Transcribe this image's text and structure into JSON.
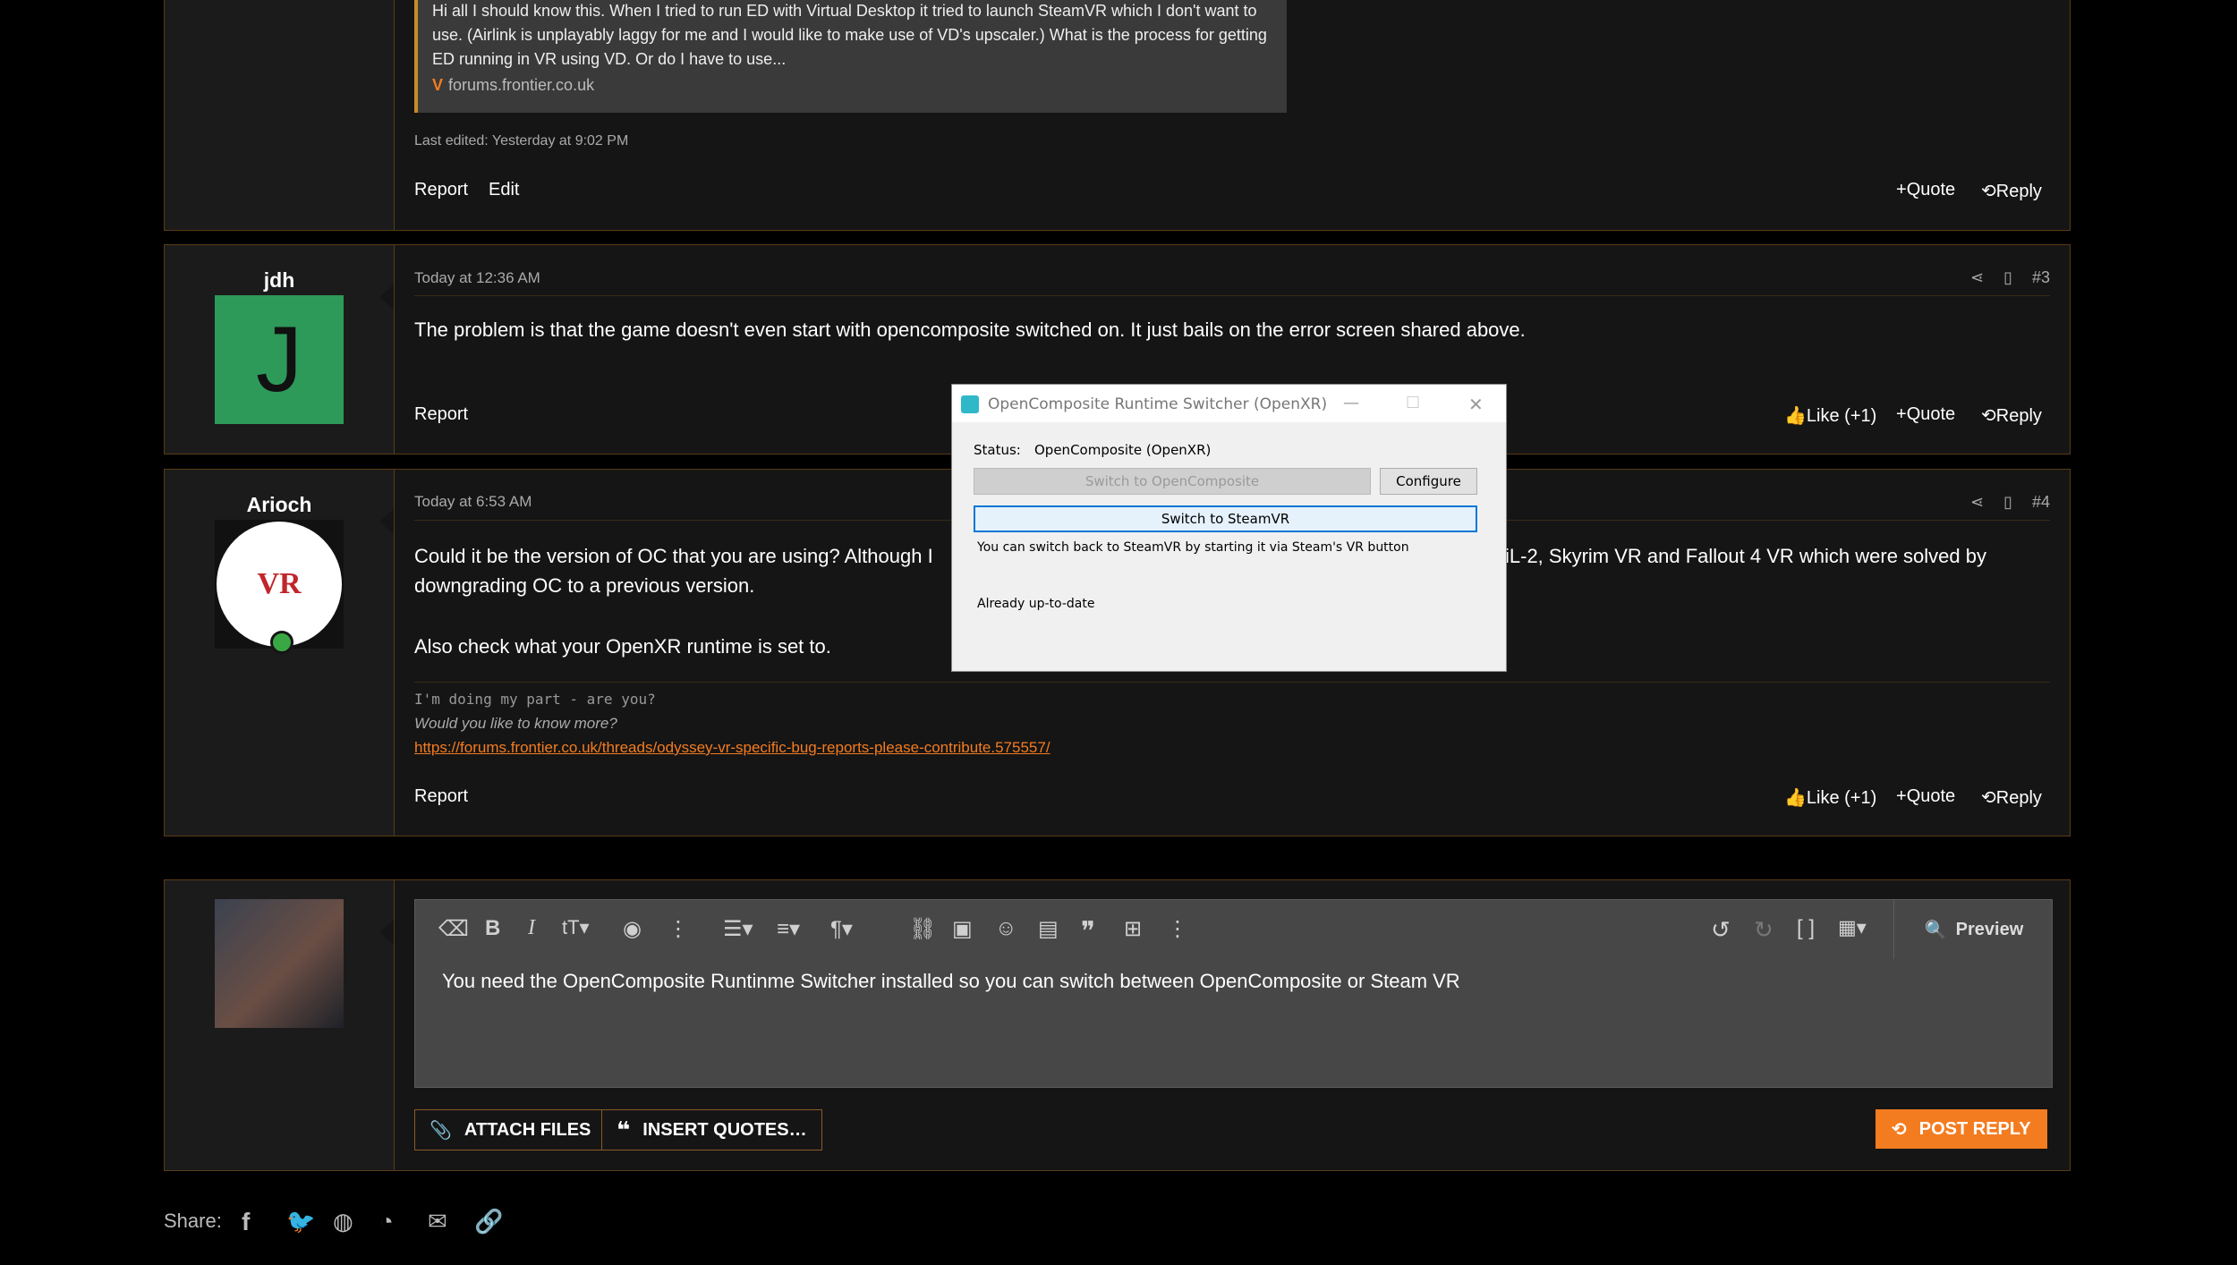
{
  "post2": {
    "quote_text": "Hi all I should know this. When I tried to run ED with Virtual Desktop it tried to launch SteamVR which I don't want to use. (Airlink is unplayably laggy for me and I would like to make use of VD's upscaler.) What is the process for getting ED running in VR using VD. Or do I have to use...",
    "quote_source": "forums.frontier.co.uk",
    "last_edited": "Last edited: Yesterday at 9:02 PM",
    "report": "Report",
    "edit": "Edit",
    "quote": "Quote",
    "reply": "Reply"
  },
  "post3": {
    "username": "jdh",
    "avatar_letter": "J",
    "avatar_color": "#2e9a5a",
    "time": "Today at 12:36 AM",
    "number": "#3",
    "text": "The problem is that the game doesn't even start with opencomposite switched on. It just bails on the error screen shared above.",
    "report": "Report",
    "like": "Like (+1)",
    "quote": "Quote",
    "reply": "Reply"
  },
  "post4": {
    "username": "Arioch",
    "avatar_text": "VR",
    "time": "Today at 6:53 AM",
    "number": "#4",
    "text_a": "Could it be the version of OC that you are using? Although I",
    "text_b": "iL-2, Skyrim VR and Fallout 4 VR which were solved by",
    "text_c": "downgrading OC to a previous version.",
    "text_d": "Also check what your OpenXR runtime is set to.",
    "sig1": "I'm doing my part - are you?",
    "sig2": "Would you like to know more?",
    "sig_link": "https://forums.frontier.co.uk/threads/odyssey-vr-specific-bug-reports-please-contribute.575557/",
    "report": "Report",
    "like": "Like (+1)",
    "quote": "Quote",
    "reply": "Reply"
  },
  "editor": {
    "text": "You need the OpenComposite Runtinme Switcher installed so you can switch between OpenComposite or Steam VR",
    "preview": "Preview",
    "attach": "ATTACH FILES",
    "insert_quotes": "INSERT QUOTES…",
    "post_reply": "POST REPLY",
    "accent": "#f47c20"
  },
  "share": {
    "label": "Share:"
  },
  "dialog": {
    "title": "OpenComposite Runtime Switcher (OpenXR)",
    "status_label": "Status:",
    "status_value": "OpenComposite (OpenXR)",
    "switch_oc": "Switch to OpenComposite",
    "configure": "Configure",
    "switch_steam": "Switch to SteamVR",
    "hint": "You can switch back to SteamVR by starting it via Steam's VR button",
    "update": "Already up-to-date"
  }
}
